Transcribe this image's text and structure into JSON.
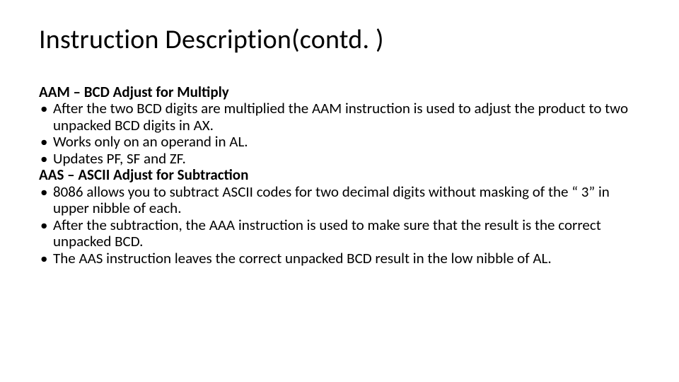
{
  "slide": {
    "title": "Instruction Description(contd. )",
    "sections": [
      {
        "heading": "AAM – BCD Adjust for Multiply",
        "bullets": [
          "After the two BCD digits are multiplied the AAM instruction is used to adjust the product to two unpacked BCD digits in AX.",
          "Works only on an operand in AL.",
          "Updates PF, SF and ZF."
        ]
      },
      {
        "heading": "AAS – ASCII Adjust for Subtraction",
        "bullets": [
          "8086 allows you to subtract ASCII codes for two decimal digits without masking of the “ 3” in upper nibble of each.",
          "After the subtraction, the AAA instruction is used to make sure that the result is the correct unpacked BCD.",
          "The AAS instruction leaves the correct unpacked BCD result in the low nibble of AL."
        ]
      }
    ]
  }
}
